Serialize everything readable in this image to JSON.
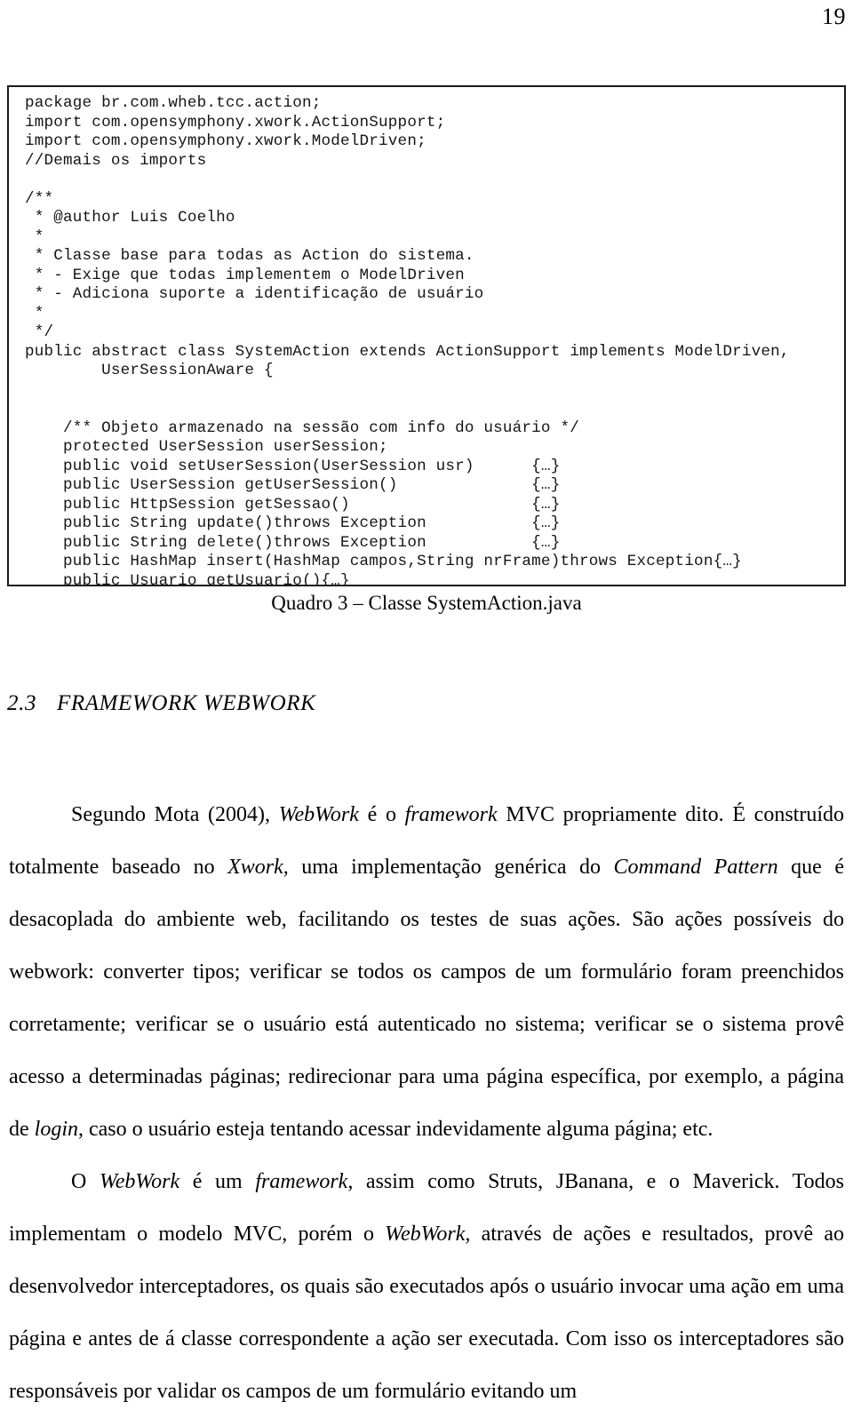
{
  "page": {
    "number": "19"
  },
  "code_listing": {
    "lines": [
      "package br.com.wheb.tcc.action;",
      "import com.opensymphony.xwork.ActionSupport;",
      "import com.opensymphony.xwork.ModelDriven;",
      "//Demais os imports",
      "",
      "/**",
      " * @author Luis Coelho",
      " *",
      " * Classe base para todas as Action do sistema.",
      " * - Exige que todas implementem o ModelDriven",
      " * - Adiciona suporte a identificação de usuário",
      " *",
      " */",
      "public abstract class SystemAction extends ActionSupport implements ModelDriven,",
      "        UserSessionAware {",
      "",
      "",
      "    /** Objeto armazenado na sessão com info do usuário */",
      "    protected UserSession userSession;",
      "    public void setUserSession(UserSession usr)      {…}",
      "    public UserSession getUserSession()              {…}",
      "    public HttpSession getSessao()                   {…}",
      "    public String update()throws Exception           {…}",
      "    public String delete()throws Exception           {…}",
      "    public HashMap insert(HashMap campos,String nrFrame)throws Exception{…}",
      "    public Usuario getUsuario(){…}"
    ]
  },
  "caption": {
    "text": "Quadro 3 – Classe SystemAction.java"
  },
  "section": {
    "number": "2.3",
    "title": "FRAMEWORK WEBWORK"
  },
  "paragraphs": [
    {
      "id": "para-1",
      "indent": true,
      "runs": [
        {
          "text": "Segundo Mota (2004), ",
          "style": "normal"
        },
        {
          "text": "WebWork",
          "style": "italic"
        },
        {
          "text": " é o ",
          "style": "normal"
        },
        {
          "text": "framework",
          "style": "italic"
        },
        {
          "text": " MVC propriamente dito. É construído totalmente baseado no ",
          "style": "normal"
        },
        {
          "text": "Xwork,",
          "style": "italic"
        },
        {
          "text": " uma implementação genérica do ",
          "style": "normal"
        },
        {
          "text": "Command Pattern",
          "style": "italic"
        },
        {
          "text": " que é desacoplada do ambiente web, facilitando os testes de suas ações. São ações possíveis do webwork: converter tipos; verificar se todos os campos de um formulário foram preenchidos corretamente; verificar se o usuário está autenticado no sistema; verificar se o sistema provê acesso a determinadas páginas; redirecionar para uma página específica, por exemplo, a página de ",
          "style": "normal"
        },
        {
          "text": "login",
          "style": "italic"
        },
        {
          "text": ", caso o usuário esteja tentando acessar indevidamente alguma página; etc.",
          "style": "normal"
        }
      ]
    },
    {
      "id": "para-2",
      "indent": true,
      "runs": [
        {
          "text": "O ",
          "style": "normal"
        },
        {
          "text": "WebWork",
          "style": "italic"
        },
        {
          "text": " é um ",
          "style": "normal"
        },
        {
          "text": "framework",
          "style": "italic"
        },
        {
          "text": ", assim como Struts, JBanana, e o  Maverick. Todos implementam o modelo MVC, porém o ",
          "style": "normal"
        },
        {
          "text": "WebWork,",
          "style": "italic"
        },
        {
          "text": " através de ações e resultados, provê ao desenvolvedor interceptadores, os quais são executados após o usuário invocar uma ação em uma página e antes de á classe correspondente a ação ser executada. Com isso os interceptadores são responsáveis por validar os campos de um formulário evitando um",
          "style": "normal"
        }
      ]
    }
  ]
}
